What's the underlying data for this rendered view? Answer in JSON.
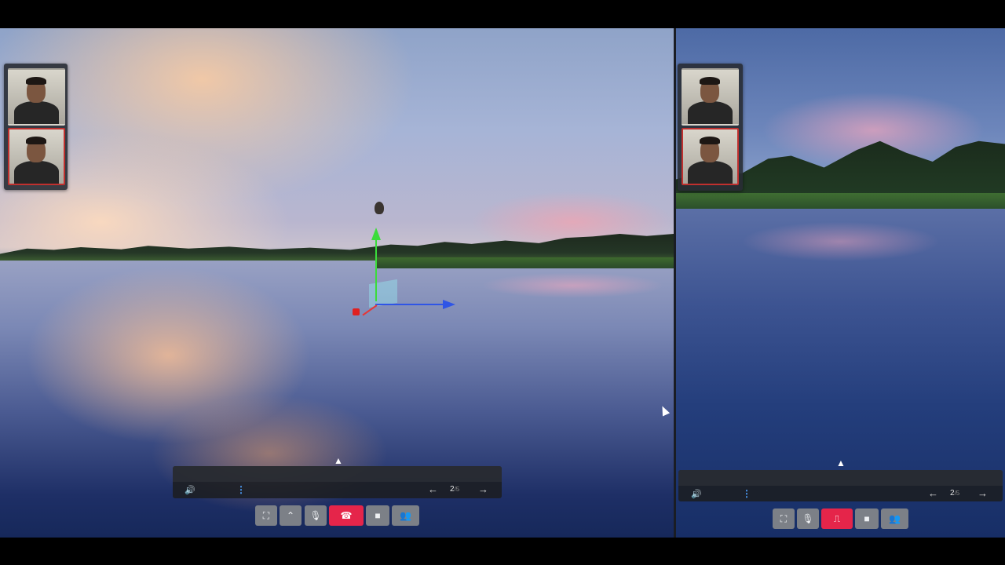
{
  "left_pane": {
    "pager": {
      "current": "2",
      "total": "/5"
    },
    "icons": {
      "toggle": "▲",
      "speaker": "🔊",
      "menu": "⋮",
      "prev": "←",
      "next": "→"
    },
    "buttons": {
      "fullscreen": "⛶",
      "expand": "⌃",
      "mic": "🎙",
      "hangup": "☎",
      "camera": "■",
      "participants": "👥"
    }
  },
  "right_pane": {
    "pager": {
      "current": "2",
      "total": "/5"
    },
    "icons": {
      "toggle": "▲",
      "speaker": "🔊",
      "menu": "⋮",
      "prev": "←",
      "next": "→"
    },
    "buttons": {
      "fullscreen": "⛶",
      "mic": "🎙",
      "exit": "⎍",
      "camera": "■",
      "participants": "👥"
    }
  },
  "colors": {
    "accent_blue": "#4ea1ff",
    "hangup_red": "#e5254a",
    "active_speaker_border": "#c0302e",
    "button_gray": "#7c8087"
  }
}
